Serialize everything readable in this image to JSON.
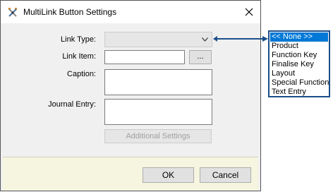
{
  "window": {
    "title": "MultiLink Button Settings"
  },
  "form": {
    "link_type_label": "Link Type:",
    "link_type_value": "",
    "link_item_label": "Link Item:",
    "link_item_value": "",
    "browse_label": "...",
    "caption_label": "Caption:",
    "caption_value": "",
    "journal_label": "Journal Entry:",
    "journal_value": "",
    "additional_settings_label": "Additional Settings"
  },
  "footer": {
    "ok_label": "OK",
    "cancel_label": "Cancel"
  },
  "dropdown": {
    "options": [
      "<< None >>",
      "Product",
      "Function Key",
      "Finalise Key",
      "Layout",
      "Special Function",
      "Text Entry"
    ],
    "selected_index": 0
  },
  "colors": {
    "selection": "#0078d7",
    "callout_border": "#1b4f8a",
    "footer_background": "#f5f5e0",
    "dialog_background": "#f0f0f0"
  },
  "icons": {
    "app": "multilink-tool-icon",
    "close": "close-icon",
    "combo_arrow": "chevron-down-icon"
  }
}
